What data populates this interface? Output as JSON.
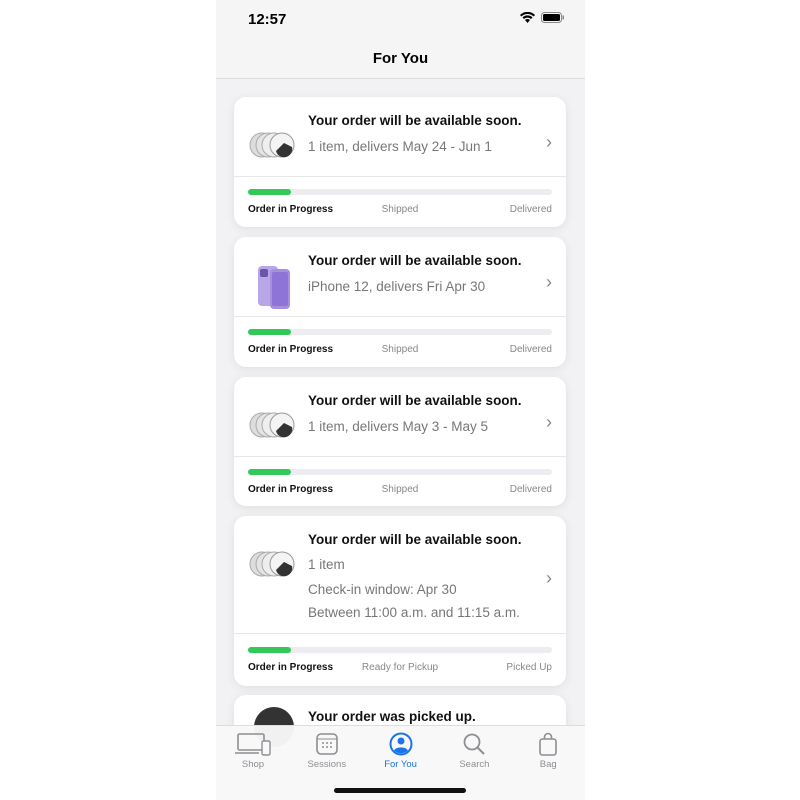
{
  "status": {
    "time": "12:57"
  },
  "nav": {
    "title": "For You"
  },
  "orders": [
    {
      "title": "Your order will be available soon.",
      "lines": [
        "1 item, delivers May 24 - Jun 1"
      ],
      "thumb": "airtag-icon",
      "progress": 0.14,
      "steps": [
        "Order in Progress",
        "Shipped",
        "Delivered"
      ]
    },
    {
      "title": "Your order will be available soon.",
      "lines": [
        "iPhone 12, delivers Fri Apr 30"
      ],
      "thumb": "iphone-icon",
      "progress": 0.14,
      "steps": [
        "Order in Progress",
        "Shipped",
        "Delivered"
      ]
    },
    {
      "title": "Your order will be available soon.",
      "lines": [
        "1 item, delivers May 3 - May 5"
      ],
      "thumb": "airtag-icon",
      "progress": 0.14,
      "steps": [
        "Order in Progress",
        "Shipped",
        "Delivered"
      ]
    },
    {
      "title": "Your order will be available soon.",
      "lines": [
        "1 item",
        "Check-in window: Apr 30",
        "Between 11:00 a.m. and 11:15 a.m."
      ],
      "thumb": "airtag-icon",
      "progress": 0.14,
      "steps": [
        "Order in Progress",
        "Ready for Pickup",
        "Picked Up"
      ]
    },
    {
      "title": "Your order was picked up.",
      "thumb": "watch-icon"
    }
  ],
  "tabs": [
    {
      "label": "Shop",
      "icon": "devices-icon"
    },
    {
      "label": "Sessions",
      "icon": "calendar-icon"
    },
    {
      "label": "For You",
      "icon": "person-circle-icon",
      "active": true
    },
    {
      "label": "Search",
      "icon": "search-icon"
    },
    {
      "label": "Bag",
      "icon": "bag-icon"
    }
  ],
  "colors": {
    "accent": "#1a73e8",
    "progress": "#34c759"
  }
}
